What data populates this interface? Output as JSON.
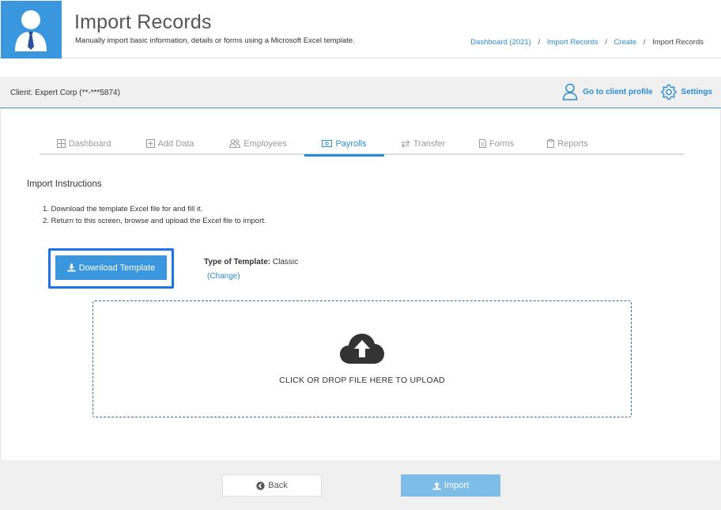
{
  "header": {
    "title": "Import Records",
    "subtitle": "Manually import basic information, details or forms using a Microsoft Excel template.",
    "breadcrumb": [
      {
        "label": "Dashboard (2021)",
        "link": true
      },
      {
        "label": "Import Records",
        "link": true
      },
      {
        "label": "Create",
        "link": true
      },
      {
        "label": "Import Records",
        "link": false
      }
    ],
    "breadcrumb_separator": "/"
  },
  "client_bar": {
    "client_label": "Client: Expert Corp (**-***5874)",
    "profile_label": "Go to client profile",
    "settings_label": "Settings"
  },
  "tabs": [
    {
      "label": "Dashboard",
      "icon": "grid-icon",
      "active": false
    },
    {
      "label": "Add Data",
      "icon": "plus-square-icon",
      "active": false
    },
    {
      "label": "Employees",
      "icon": "users-icon",
      "active": false
    },
    {
      "label": "Payrolls",
      "icon": "money-icon",
      "active": true
    },
    {
      "label": "Transfer",
      "icon": "exchange-icon",
      "active": false
    },
    {
      "label": "Forms",
      "icon": "file-icon",
      "active": false
    },
    {
      "label": "Reports",
      "icon": "clipboard-icon",
      "active": false
    }
  ],
  "instructions": {
    "title": "Import Instructions",
    "steps": [
      "1. Download the template Excel file for and fill it.",
      "2. Return to this screen, browse and upload the Excel file to import."
    ]
  },
  "template": {
    "download_label": "Download Template",
    "type_label": "Type of Template:",
    "type_value": "Classic",
    "change_label": "(Change)"
  },
  "dropzone": {
    "text": "CLICK OR DROP FILE HERE TO UPLOAD"
  },
  "footer": {
    "back_label": "Back",
    "import_label": "Import"
  },
  "colors": {
    "accent": "#3a97dd",
    "link": "#2a8bd5",
    "highlight_border": "#1a73e8",
    "import_disabled": "#7fbde9"
  }
}
